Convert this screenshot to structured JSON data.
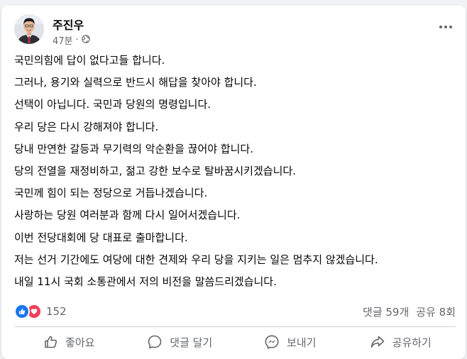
{
  "post": {
    "author": "주진우",
    "time": "47분",
    "separator": "·",
    "lines": [
      "국민의힘에 답이 없다고들 합니다.",
      "그러나, 용기와 실력으로 반드시 해답을 찾아야 합니다.",
      "선택이 아닙니다. 국민과 당원의 명령입니다.",
      "우리 당은 다시 강해져야 합니다.",
      "당내 만연한 갈등과 무기력의 악순환을 끊어야 합니다.",
      "당의 전열을 재정비하고, 젊고 강한 보수로 탈바꿈시키겠습니다.",
      "국민께 힘이 되는 정당으로 거듭나겠습니다.",
      "사랑하는 당원 여러분과 함께 다시 일어서겠습니다.",
      "이번 전당대회에 당 대표로 출마합니다.",
      "저는 선거 기간에도 여당에 대한 견제와 우리 당을 지키는 일은 멈추지 않겠습니다.",
      "내일 11시 국회 소통관에서 저의 비전을 말씀드리겠습니다."
    ]
  },
  "stats": {
    "reaction_count": "152",
    "comments": "댓글 59개",
    "shares": "공유 8회",
    "reaction_icons": [
      "like-icon",
      "love-icon"
    ]
  },
  "actions": {
    "like": "좋아요",
    "comment": "댓글 달기",
    "send": "보내기",
    "share": "공유하기"
  },
  "colors": {
    "accent": "#1877f2",
    "love": "#f33e58",
    "secondary_text": "#65676b",
    "text": "#050505",
    "background": "#f0f2f5"
  }
}
